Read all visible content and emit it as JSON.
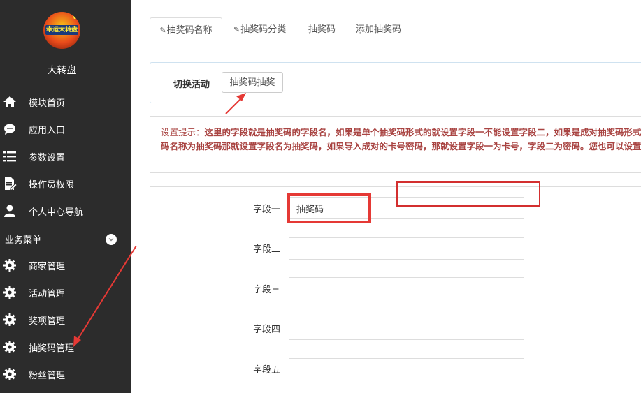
{
  "sidebar": {
    "app_title": "大转盘",
    "avatar": {
      "text": "幸运大转盘",
      "mark": "V"
    },
    "items": [
      {
        "label": "模块首页",
        "icon": "home-icon"
      },
      {
        "label": "应用入口",
        "icon": "chat-bubble-icon"
      },
      {
        "label": "参数设置",
        "icon": "list-icon"
      },
      {
        "label": "操作员权限",
        "icon": "document-edit-icon"
      },
      {
        "label": "个人中心导航",
        "icon": "user-icon"
      }
    ],
    "section": {
      "label": "业务菜单",
      "icon": "chevron-down-icon"
    },
    "business_items": [
      {
        "label": "商家管理",
        "icon": "gear-icon"
      },
      {
        "label": "活动管理",
        "icon": "gear-icon"
      },
      {
        "label": "奖项管理",
        "icon": "gear-icon"
      },
      {
        "label": "抽奖码管理",
        "icon": "gear-icon"
      },
      {
        "label": "粉丝管理",
        "icon": "gear-icon"
      }
    ]
  },
  "tabs": [
    {
      "label": "抽奖码名称",
      "icon": "edit-icon",
      "active": true
    },
    {
      "label": "抽奖码分类",
      "icon": "edit-icon",
      "active": false
    },
    {
      "label": "抽奖码",
      "active": false
    },
    {
      "label": "添加抽奖码",
      "active": false
    }
  ],
  "switch_panel": {
    "label": "切换活动",
    "button": "抽奖码抽奖"
  },
  "hint": {
    "prefix": "设置提示：",
    "line1": "这里的字段就是抽奖码的字段名，如果是单个抽奖码形式的就设置字段一不能设置字段二，如果是成对抽奖码形式",
    "line2": "码名称为抽奖码那就设置字段名为抽奖码，如果导入成对的卡号密码，那就设置字段一为卡号，字段二为密码。您也可以设置"
  },
  "form": {
    "fields": [
      {
        "label": "字段一",
        "value": "抽奖码"
      },
      {
        "label": "字段二",
        "value": ""
      },
      {
        "label": "字段三",
        "value": ""
      },
      {
        "label": "字段四",
        "value": ""
      },
      {
        "label": "字段五",
        "value": ""
      }
    ]
  },
  "colors": {
    "sidebar_bg": "#2c2c2c",
    "hint_text": "#a94442",
    "annotation_red": "#e53935"
  }
}
